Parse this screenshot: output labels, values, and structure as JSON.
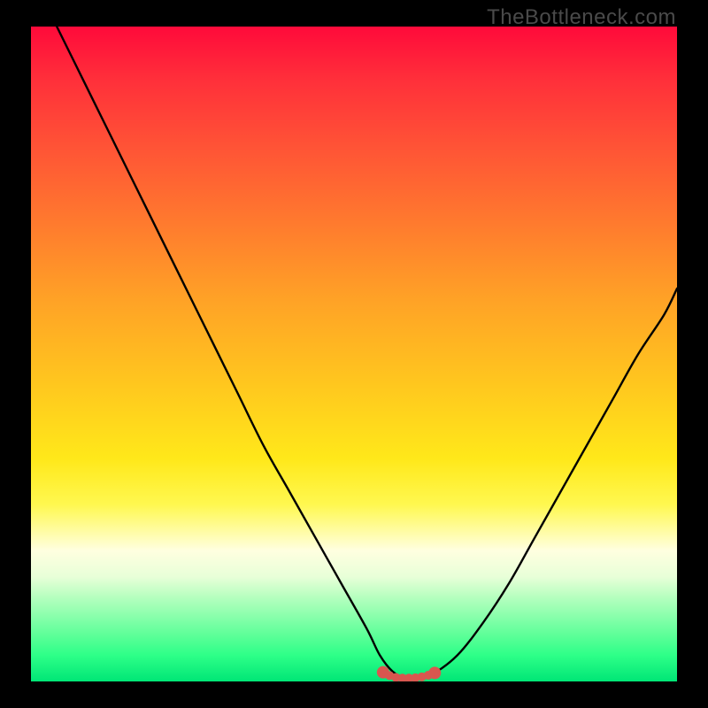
{
  "watermark": "TheBottleneck.com",
  "colors": {
    "black": "#000000",
    "curve": "#000000",
    "marker": "#d9564f"
  },
  "chart_data": {
    "type": "line",
    "title": "",
    "xlabel": "",
    "ylabel": "",
    "xlim": [
      0,
      100
    ],
    "ylim": [
      0,
      100
    ],
    "grid": false,
    "legend": false,
    "series": [
      {
        "name": "bottleneck-curve",
        "x": [
          4,
          8,
          12,
          16,
          20,
          24,
          28,
          32,
          36,
          40,
          44,
          48,
          52,
          54,
          56,
          58,
          60,
          62,
          66,
          70,
          74,
          78,
          82,
          86,
          90,
          94,
          98,
          100
        ],
        "y": [
          100,
          92,
          84,
          76,
          68,
          60,
          52,
          44,
          36,
          29,
          22,
          15,
          8,
          4,
          1.5,
          0.5,
          0.5,
          1,
          4,
          9,
          15,
          22,
          29,
          36,
          43,
          50,
          56,
          60
        ]
      }
    ],
    "markers": {
      "name": "optimal-range",
      "x": [
        54.5,
        55.5,
        56.5,
        57.5,
        58.5,
        59.5,
        60.5,
        61.5,
        62.5
      ],
      "y": [
        1.4,
        0.9,
        0.6,
        0.5,
        0.5,
        0.55,
        0.7,
        0.95,
        1.3
      ]
    },
    "background_gradient": {
      "orientation": "vertical",
      "stops": [
        {
          "pos": 0.0,
          "color": "#ff0a3a"
        },
        {
          "pos": 0.3,
          "color": "#ff7a2e"
        },
        {
          "pos": 0.55,
          "color": "#ffc81e"
        },
        {
          "pos": 0.8,
          "color": "#ffffe0"
        },
        {
          "pos": 1.0,
          "color": "#00e676"
        }
      ]
    }
  }
}
